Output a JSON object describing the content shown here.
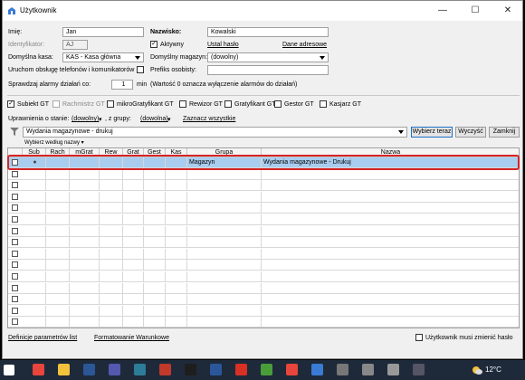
{
  "window": {
    "title": "Użytkownik",
    "minimize": "—",
    "maximize": "☐",
    "close": "✕"
  },
  "form": {
    "imie_label": "Imię:",
    "imie_value": "Jan",
    "nazwisko_label": "Nazwisko:",
    "nazwisko_value": "Kowalski",
    "identyfikator_label": "Identyfikator:",
    "identyfikator_value": "AJ",
    "aktywny_label": "Aktywny",
    "aktywny_checked": "✓",
    "ustal_haslo": "Ustal hasło",
    "dane_adresowe": "Dane adresowe",
    "kasa_label": "Domyślna kasa:",
    "kasa_value": "KAS - Kasa główna",
    "magazyn_label": "Domyślny magazyn:",
    "magazyn_value": "(dowolny)",
    "uruchom_label": "Uruchom obsługę telefonów i komunikatorów",
    "prefiks_label": "Prefiks osobisty:",
    "alarmy_label": "Sprawdzaj alarmy działań co:",
    "alarmy_value": "1",
    "alarmy_unit": "min",
    "alarmy_note": "(Wartość 0 oznacza wyłączenie alarmów do działań)"
  },
  "roles": [
    {
      "label": "Subiekt GT",
      "checked": "✓",
      "disabled": false
    },
    {
      "label": "Rachmistrz GT",
      "checked": "",
      "disabled": true
    },
    {
      "label": "mikroGratyfikant GT",
      "checked": "",
      "disabled": false
    },
    {
      "label": "Rewizor GT",
      "checked": "",
      "disabled": false
    },
    {
      "label": "Gratyfikant GT",
      "checked": "",
      "disabled": false
    },
    {
      "label": "Gestor GT",
      "checked": "",
      "disabled": false
    },
    {
      "label": "Kasjarz GT",
      "checked": "",
      "disabled": false
    }
  ],
  "permissions": {
    "label": "Uprawnienia o stanie:",
    "stan_value": "(dowolny)",
    "grupy_label": ", z grupy:",
    "grupy_value": "(dowolna)",
    "zaznacz": "Zaznacz wszystkie"
  },
  "filter": {
    "value": "Wydania magazynowe - drukuj",
    "wybierz_teraz": "Wybierz teraz",
    "wyczysc": "Wyczyść",
    "zamknij": "Zamknij",
    "sort_label": "Wybierz według nazwy ▾"
  },
  "grid": {
    "columns": [
      "Sub",
      "Rach",
      "mGrat",
      "Rew",
      "Grat",
      "Gest",
      "Kas",
      "Grupa",
      "Nazwa"
    ],
    "rows": [
      {
        "sub": "●",
        "grupa": "Magazyn",
        "nazwa": "Wydania magazynowe - Drukuj"
      }
    ]
  },
  "footer": {
    "definicje": "Definicje parametrów list",
    "formatowanie": "Formatowanie Warunkowe",
    "musi_zmienic": "Użytkownik musi zmienić hasło"
  },
  "taskbar": {
    "weather": "12°C",
    "icons": [
      "chrome-icon",
      "explorer-icon",
      "word-icon",
      "teams-icon",
      "calendar-icon",
      "gt-icon",
      "m-app-icon",
      "word-icon",
      "pdf-icon",
      "notepad-icon",
      "chrome-icon",
      "app-icon",
      "app-icon",
      "app-icon",
      "settings-icon",
      "app-icon"
    ]
  },
  "colors": {
    "selection": "#a9cdef",
    "highlight_border": "#d42525",
    "button_focus": "#1e6fc8"
  }
}
